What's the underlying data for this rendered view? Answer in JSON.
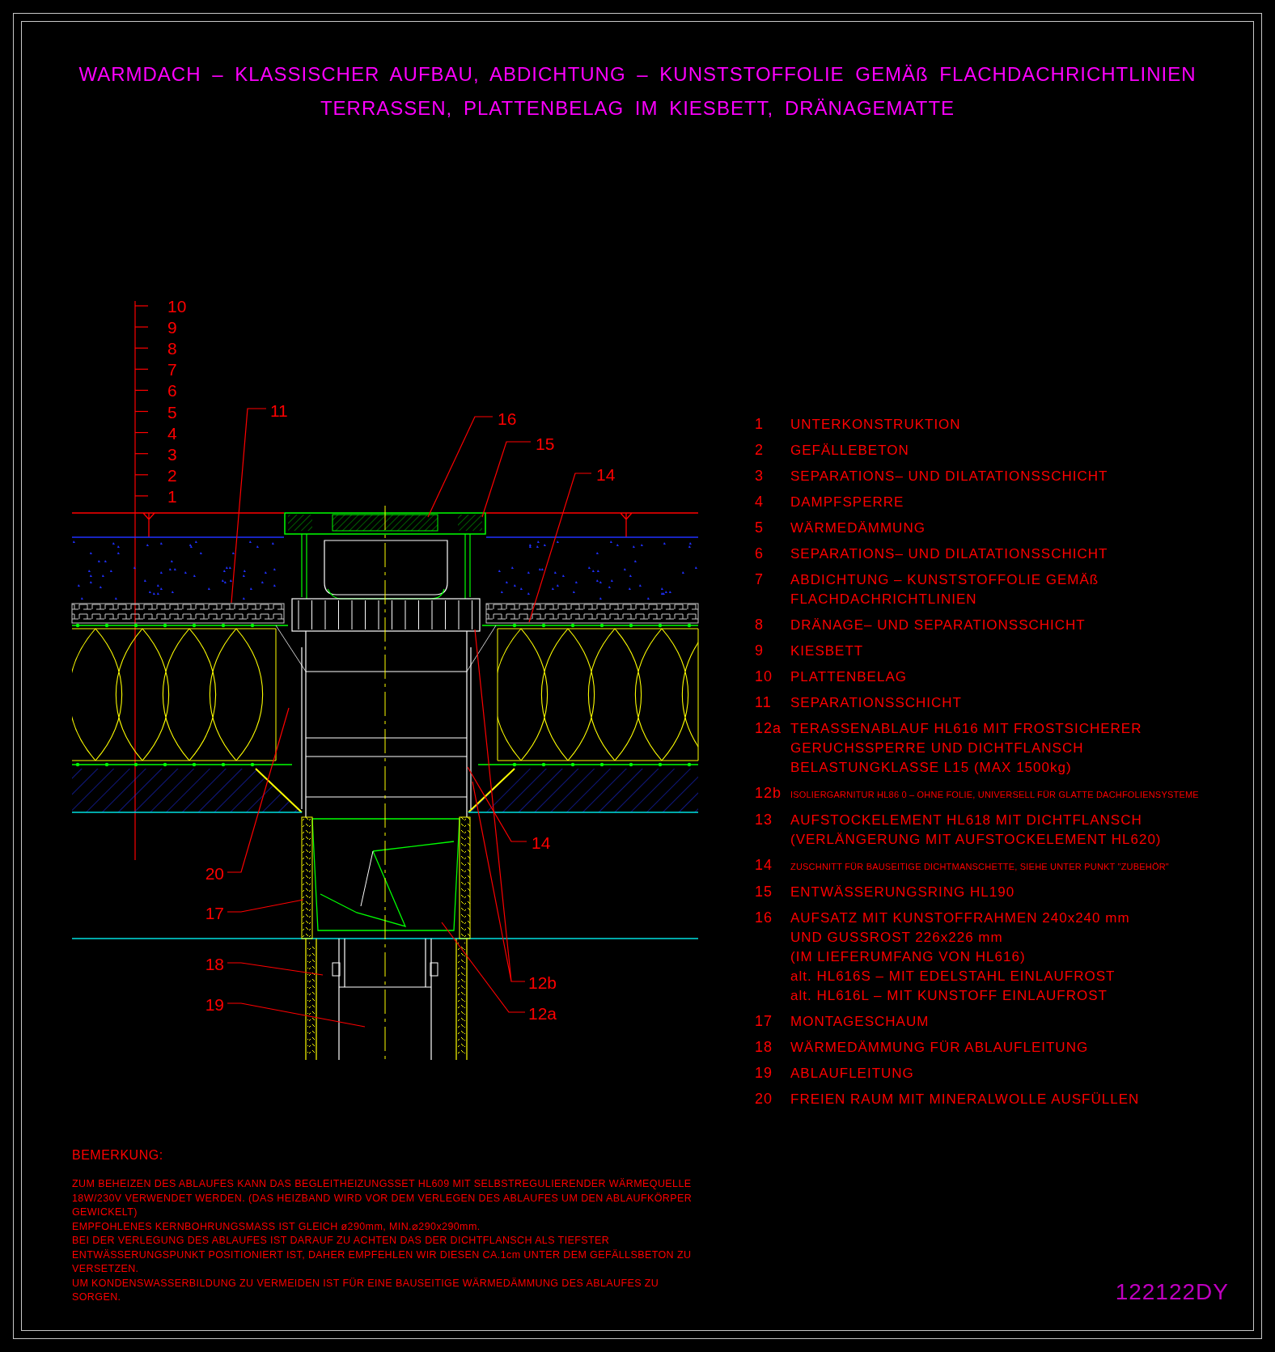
{
  "title": {
    "lines": [
      "WARMDACH – KLASSISCHER AUFBAU, ABDICHTUNG – KUNSTSTOFFOLIE GEMÄß FLACHDACHRICHTLINIEN",
      "TERRASSEN, PLATTENBELAG IM KIESBETT, DRÄNAGEMATTE"
    ]
  },
  "drawing": {
    "scale_labels": [
      "10",
      "9",
      "8",
      "7",
      "6",
      "5",
      "4",
      "3",
      "2",
      "1"
    ],
    "callouts": [
      {
        "label": "11"
      },
      {
        "label": "16"
      },
      {
        "label": "15"
      },
      {
        "label": "14"
      },
      {
        "label": "14"
      },
      {
        "label": "12b"
      },
      {
        "label": "12a"
      },
      {
        "label": "20"
      },
      {
        "label": "17"
      },
      {
        "label": "18"
      },
      {
        "label": "19"
      }
    ]
  },
  "legend": [
    {
      "number": "1",
      "kind": "normal",
      "lines": [
        "UNTERKONSTRUKTION"
      ]
    },
    {
      "number": "2",
      "kind": "normal",
      "lines": [
        "GEFÄLLEBETON"
      ]
    },
    {
      "number": "3",
      "kind": "normal",
      "lines": [
        "SEPARATIONS– UND DILATATIONSSCHICHT"
      ]
    },
    {
      "number": "4",
      "kind": "normal",
      "lines": [
        "DAMPFSPERRE"
      ]
    },
    {
      "number": "5",
      "kind": "normal",
      "lines": [
        "WÄRMEDÄMMUNG"
      ]
    },
    {
      "number": "6",
      "kind": "normal",
      "lines": [
        "SEPARATIONS– UND DILATATIONSSCHICHT"
      ]
    },
    {
      "number": "7",
      "kind": "normal",
      "lines": [
        "ABDICHTUNG – KUNSTSTOFFOLIE GEMÄß",
        "FLACHDACHRICHTLINIEN"
      ]
    },
    {
      "number": "8",
      "kind": "normal",
      "lines": [
        "DRÄNAGE– UND SEPARATIONSSCHICHT"
      ]
    },
    {
      "number": "9",
      "kind": "normal",
      "lines": [
        "KIESBETT"
      ]
    },
    {
      "number": "10",
      "kind": "normal",
      "lines": [
        "PLATTENBELAG"
      ]
    },
    {
      "number": "11",
      "kind": "normal",
      "lines": [
        "SEPARATIONSSCHICHT"
      ]
    },
    {
      "number": "12a",
      "kind": "normal",
      "lines": [
        "TERASSENABLAUF HL616 MIT FROSTSICHERER",
        "GERUCHSSPERRE UND DICHTFLANSCH",
        "BELASTUNGKLASSE L15 (MAX 1500kg)"
      ]
    },
    {
      "number": "12b",
      "kind": "small",
      "lines": [
        "ISOLIERGARNITUR HL86 0 – OHNE FOLIE, UNIVERSELL FÜR GLATTE DACHFOLIENSYSTEME"
      ]
    },
    {
      "number": "13",
      "kind": "normal",
      "lines": [
        "AUFSTOCKELEMENT HL618 MIT DICHTFLANSCH",
        "(VERLÄNGERUNG MIT AUFSTOCKELEMENT HL620)"
      ]
    },
    {
      "number": "14",
      "kind": "small",
      "lines": [
        "ZUSCHNITT FÜR BAUSEITIGE DICHTMANSCHETTE, SIEHE UNTER PUNKT \"ZUBEHÖR\""
      ]
    },
    {
      "number": "15",
      "kind": "normal",
      "lines": [
        "ENTWÄSSERUNGSRING HL190"
      ]
    },
    {
      "number": "16",
      "kind": "normal",
      "lines": [
        "AUFSATZ MIT KUNSTOFFRAHMEN 240x240 mm",
        "UND GUSSROST 226x226 mm",
        "(IM LIEFERUMFANG VON HL616)",
        "alt. HL616S – MIT EDELSTAHL EINLAUFROST",
        "alt. HL616L – MIT KUNSTOFF EINLAUFROST"
      ]
    },
    {
      "number": "17",
      "kind": "normal",
      "lines": [
        "MONTAGESCHAUM"
      ]
    },
    {
      "number": "18",
      "kind": "normal",
      "lines": [
        "WÄRMEDÄMMUNG FÜR ABLAUFLEITUNG"
      ]
    },
    {
      "number": "19",
      "kind": "normal",
      "lines": [
        "ABLAUFLEITUNG"
      ]
    },
    {
      "number": "20",
      "kind": "normal",
      "lines": [
        "FREIEN RAUM MIT MINERALWOLLE AUSFÜLLEN"
      ]
    }
  ],
  "notes": {
    "heading": "BEMERKUNG:",
    "paragraphs": [
      "ZUM BEHEIZEN DES ABLAUFES KANN DAS BEGLEITHEIZUNGSSET HL609 MIT SELBSTREGULIERENDER WÄRMEQUELLE 18W/230V VERWENDET WERDEN. (DAS HEIZBAND WIRD VOR DEM VERLEGEN DES ABLAUFES UM DEN ABLAUFKÖRPER GEWICKELT)",
      "EMPFOHLENES KERNBOHRUNGSMASS IST GLEICH ø290mm, MIN.⌀290x290mm.",
      "BEI DER VERLEGUNG DES ABLAUFES IST DARAUF ZU ACHTEN DAS DER DICHTFLANSCH ALS TIEFSTER ENTWÄSSERUNGSPUNKT POSITIONIERT IST, DAHER EMPFEHLEN WIR DIESEN CA.1cm UNTER DEM GEFÄLLSBETON ZU VERSETZEN.",
      "UM KONDENSWASSERBILDUNG ZU VERMEIDEN IST FÜR EINE BAUSEITIGE WÄRMEDÄMMUNG DES ABLAUFES ZU SORGEN."
    ]
  },
  "drawing_number": "122122DY"
}
